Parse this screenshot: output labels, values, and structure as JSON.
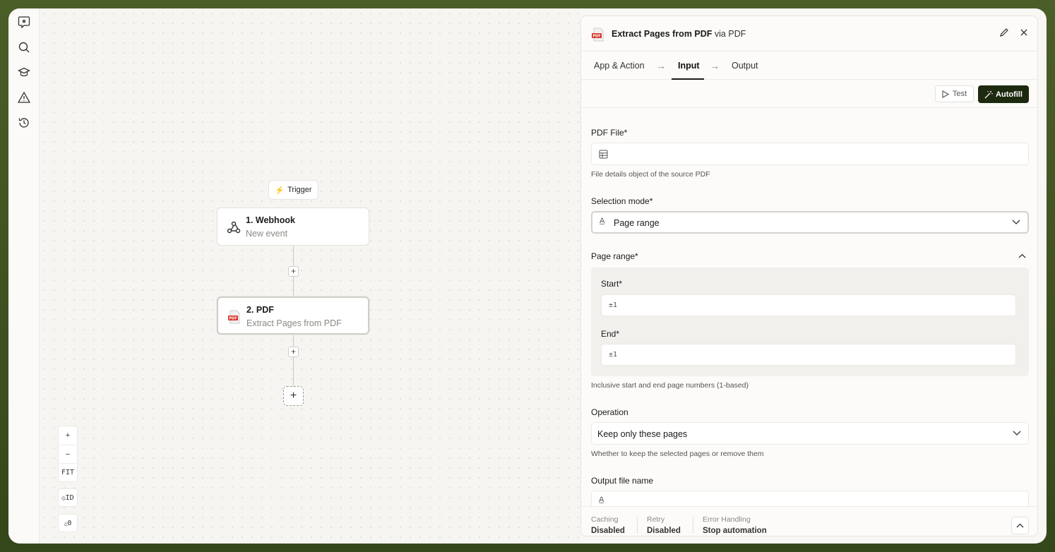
{
  "canvas": {
    "trigger_label": "Trigger",
    "nodes": [
      {
        "title": "1. Webhook",
        "subtitle": "New event"
      },
      {
        "title": "2. PDF",
        "subtitle": "Extract Pages from PDF"
      }
    ],
    "zoom": {
      "in": "+",
      "out": "−",
      "fit": "FIT",
      "id": "ID",
      "warn_count": "0"
    }
  },
  "panel": {
    "title": "Extract Pages from PDF",
    "title_via": "via PDF",
    "tabs": [
      "App & Action",
      "Input",
      "Output"
    ],
    "active_tab": "Input",
    "test_label": "Test",
    "autofill_label": "Autofill",
    "fields": {
      "pdf_file": {
        "label": "PDF File*",
        "help": "File details object of the source PDF"
      },
      "selection_mode": {
        "label": "Selection mode*",
        "value": "Page range"
      },
      "page_range": {
        "label": "Page range*",
        "start_label": "Start*",
        "start_value": "±1",
        "end_label": "End*",
        "end_value": "±1",
        "help": "Inclusive start and end page numbers (1-based)"
      },
      "operation": {
        "label": "Operation",
        "value": "Keep only these pages",
        "help": "Whether to keep the selected pages or remove them"
      },
      "output_file_name": {
        "label": "Output file name"
      }
    },
    "footer": [
      {
        "key": "Caching",
        "value": "Disabled"
      },
      {
        "key": "Retry",
        "value": "Disabled"
      },
      {
        "key": "Error Handling",
        "value": "Stop automation"
      }
    ]
  },
  "colors": {
    "accent_dark": "#1e2a10",
    "pdf_red": "#d9332b",
    "frame_green": "#3c4f1f"
  }
}
